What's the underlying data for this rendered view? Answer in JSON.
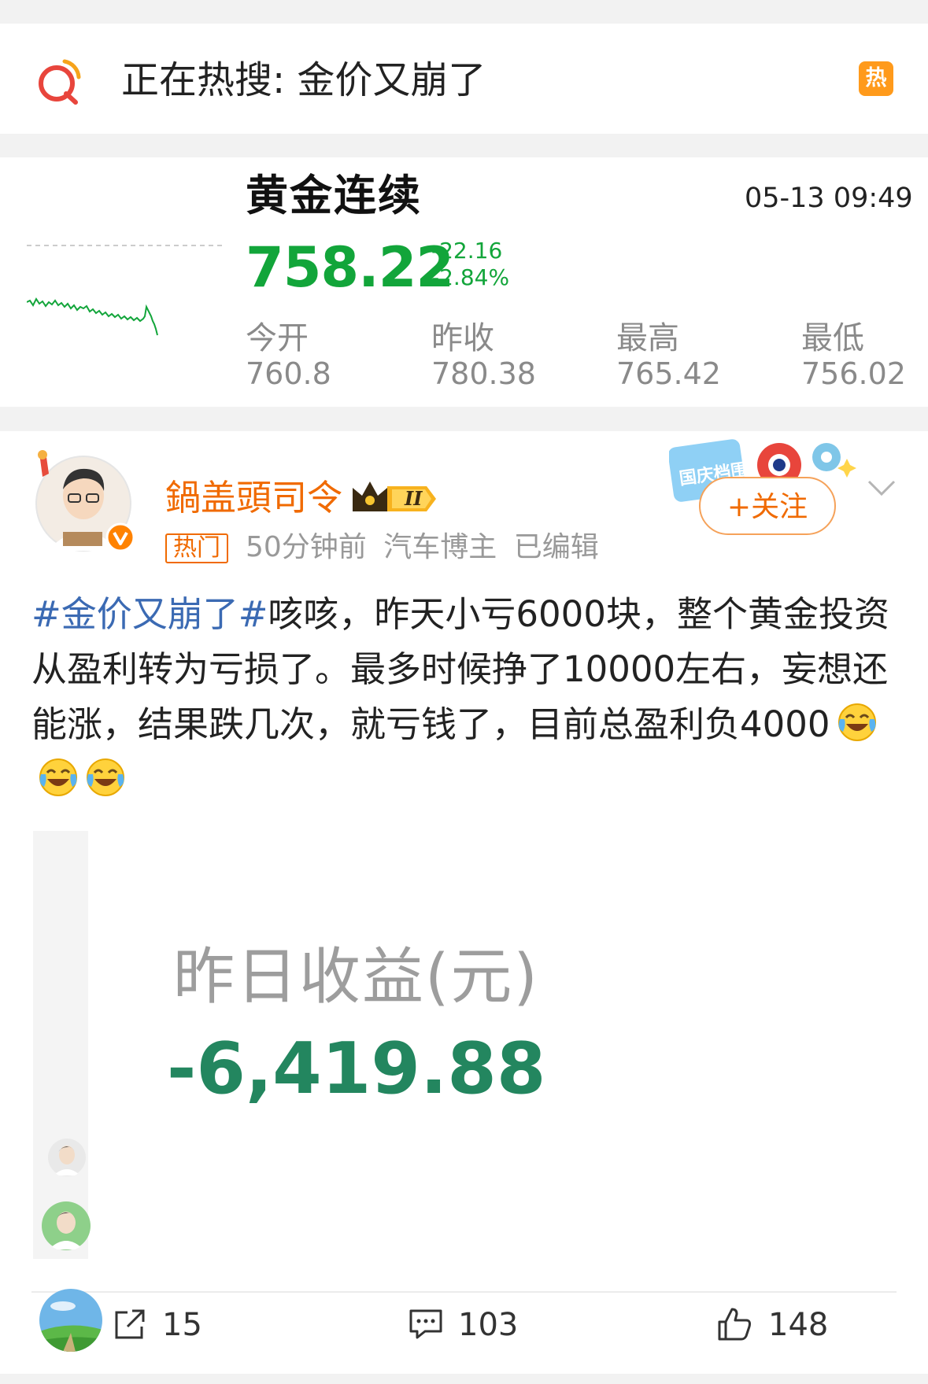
{
  "hot_search": {
    "text": "正在热搜: 金价又崩了",
    "badge": "热"
  },
  "stock": {
    "name": "黄金连续",
    "time": "05-13 09:49",
    "price": "758.22",
    "change": "-22.16",
    "change_pct": "-2.84%",
    "stats": [
      {
        "label": "今开",
        "value": "760.8"
      },
      {
        "label": "昨收",
        "value": "780.38"
      },
      {
        "label": "最高",
        "value": "765.42"
      },
      {
        "label": "最低",
        "value": "756.02"
      }
    ],
    "color_down": "#12a53a"
  },
  "post": {
    "username": "鍋盖頭司令",
    "tag": "热门",
    "meta": "50分钟前 汽车博主 已编辑",
    "follow_label": "+关注",
    "hashtag": "#金价又崩了#",
    "text": "咳咳，昨天小亏6000块，整个黄金投资从盈利转为亏损了。最多时候挣了10000左右，妄想还能涨，结果跌几次，就亏钱了，目前总盈利负4000",
    "emoji_count": 3,
    "promo_text": "国庆档围观",
    "image": {
      "label": "昨日收益(元)",
      "value": "-6,419.88"
    }
  },
  "actions": {
    "repost": "15",
    "comment": "103",
    "like": "148"
  },
  "colors": {
    "accent": "#f06a00",
    "link": "#3b6ab3",
    "hot_badge": "#ff9a1b",
    "gain_green": "#23865f"
  }
}
